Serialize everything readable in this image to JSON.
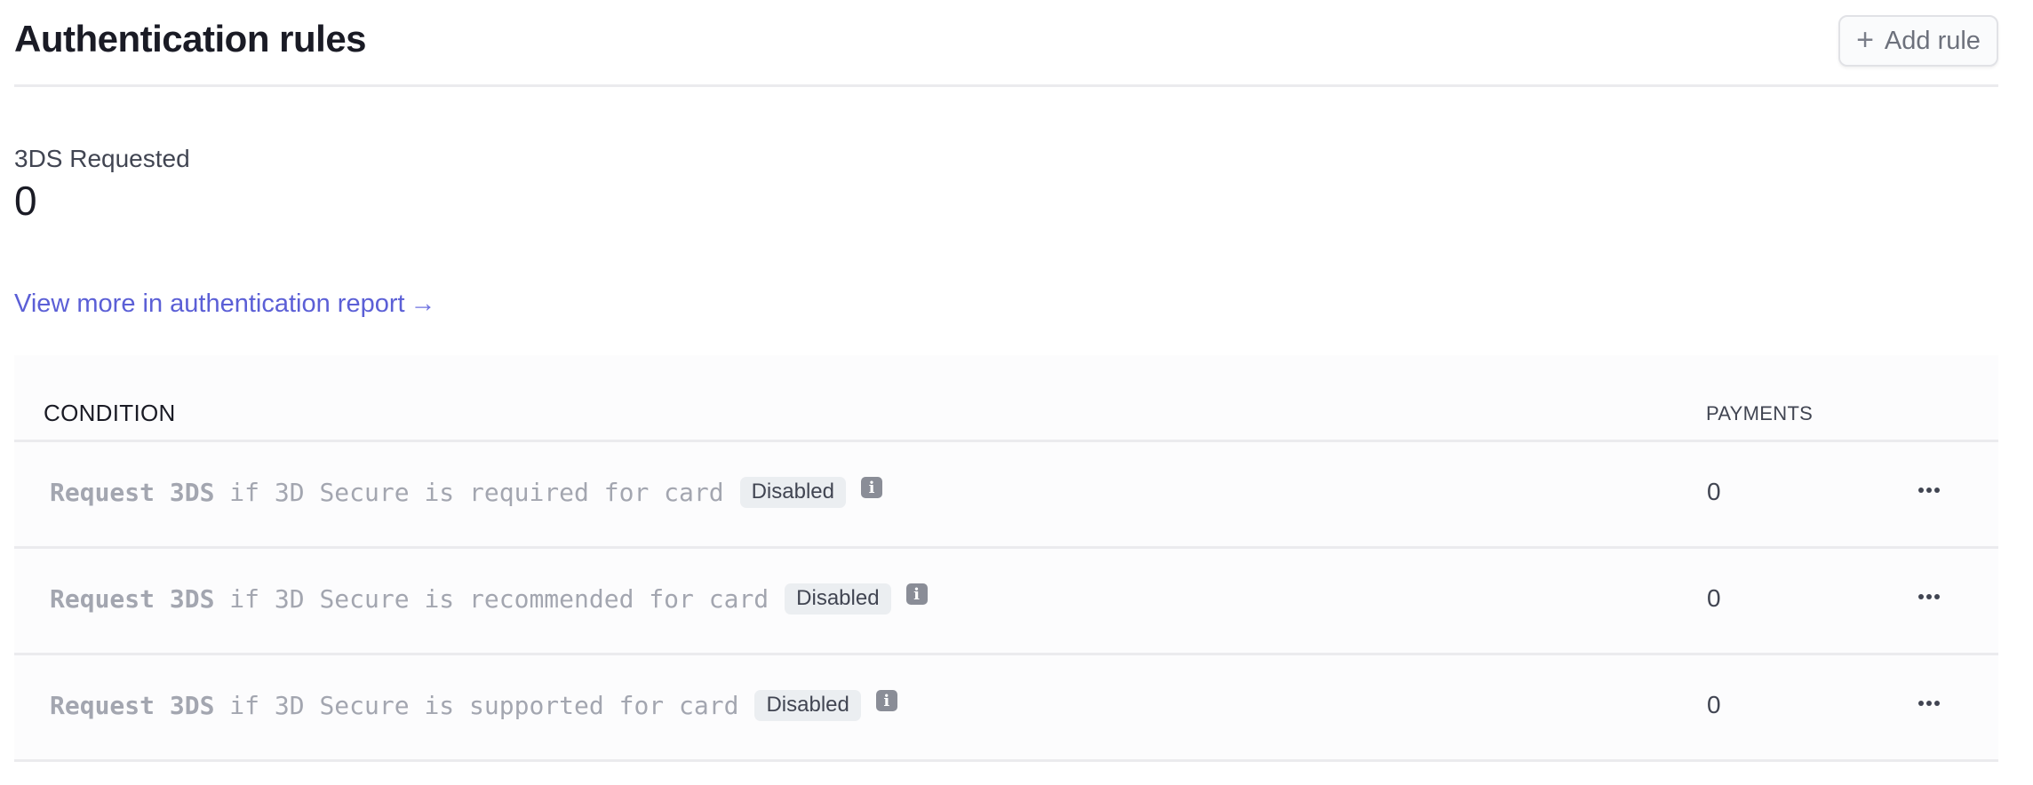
{
  "header": {
    "title": "Authentication rules",
    "add_button": {
      "icon": "plus-icon",
      "label": "Add rule"
    }
  },
  "metric": {
    "label": "3DS Requested",
    "value": "0"
  },
  "report_link": {
    "label": "View more in authentication report",
    "icon": "arrow-right-icon",
    "color": "#5b5fd6"
  },
  "table": {
    "columns": {
      "condition": "CONDITION",
      "payments": "PAYMENTS"
    },
    "rows": [
      {
        "action": "Request 3DS",
        "condition": " if 3D Secure is required for card",
        "status": "Disabled",
        "payments": "0"
      },
      {
        "action": "Request 3DS",
        "condition": " if 3D Secure is recommended for card",
        "status": "Disabled",
        "payments": "0"
      },
      {
        "action": "Request 3DS",
        "condition": " if 3D Secure is supported for card",
        "status": "Disabled",
        "payments": "0"
      }
    ],
    "info_icon": "i",
    "more_icon": "ellipsis-icon"
  }
}
